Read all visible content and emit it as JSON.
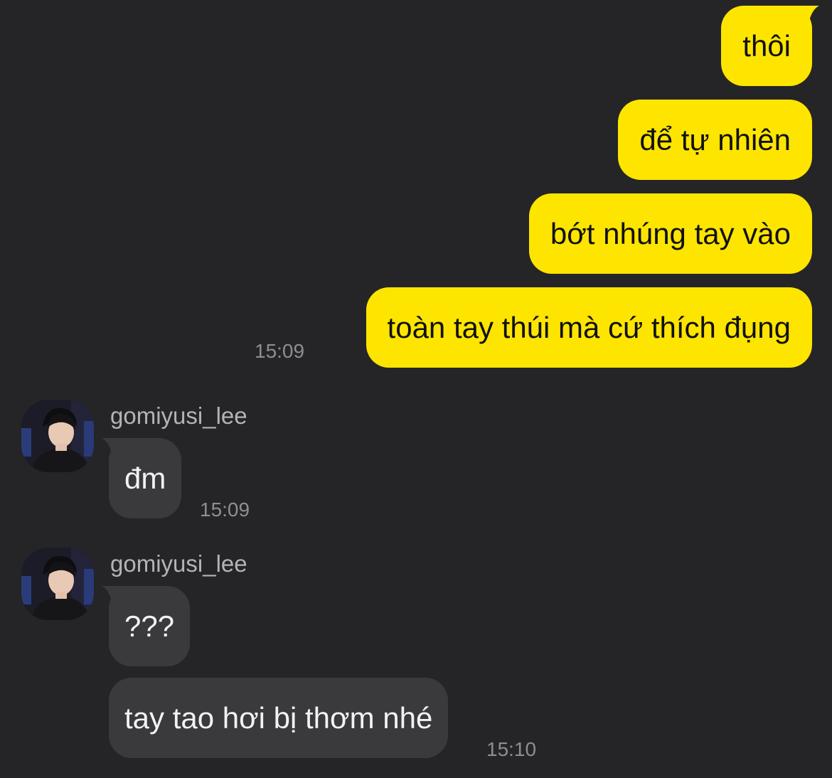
{
  "outgoing": [
    {
      "text": "thôi"
    },
    {
      "text": "để tự nhiên"
    },
    {
      "text": "bớt nhúng tay vào"
    },
    {
      "text": "toàn tay thúi mà cứ thích đụng"
    }
  ],
  "outgoing_time": "15:09",
  "incoming": [
    {
      "sender": "gomiyusi_lee",
      "messages": [
        {
          "text": "đm"
        }
      ],
      "time": "15:09"
    },
    {
      "sender": "gomiyusi_lee",
      "messages": [
        {
          "text": "???"
        },
        {
          "text": "tay tao hơi bị thơm nhé"
        }
      ],
      "time": "15:10"
    }
  ],
  "colors": {
    "background": "#252527",
    "outgoing_bubble": "#fee500",
    "incoming_bubble": "#3a3a3c",
    "timestamp": "#8e8e92",
    "sender_name": "#b4b4b8"
  }
}
